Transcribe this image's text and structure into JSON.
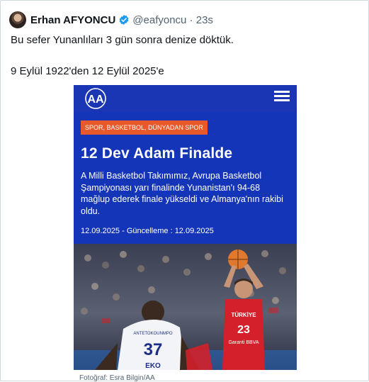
{
  "tweet": {
    "author_name": "Erhan AFYONCU",
    "handle_time": "@eafyoncu · 23s",
    "text_line1": "Bu sefer Yunanlıları 3 gün sonra denize döktük.",
    "text_line2": "9 Eylül 1922'den 12 Eylül 2025'e"
  },
  "article": {
    "logo": "AA",
    "categories": "SPOR, BASKETBOL, DÜNYADAN SPOR",
    "headline": "12 Dev Adam Finalde",
    "summary": "A Milli Basketbol Takımımız, Avrupa Basketbol Şampiyonası yarı finalinde Yunanistan'ı 94-68 mağlup ederek finale yükseldi ve Almanya'nın rakibi oldu.",
    "dateline": "12.09.2025 - Güncelleme : 12.09.2025",
    "photo": {
      "jersey_left_name": "ANTETOKOUNMPO",
      "jersey_left_number": "37",
      "jersey_left_sponsor": "EKO",
      "jersey_right_country": "TÜRKİYE",
      "jersey_right_number": "23",
      "jersey_right_sponsor": "Garanti BBVA"
    },
    "caption": "Fotoğraf: Esra Bilgin/AA"
  },
  "colors": {
    "aa_blue": "#1535b8",
    "category_orange": "#e8582a",
    "verified_blue": "#1d9bf0",
    "turkey_red": "#d3202a"
  },
  "icons": [
    "avatar",
    "verified-badge-icon",
    "aa-logo",
    "menu-icon"
  ]
}
